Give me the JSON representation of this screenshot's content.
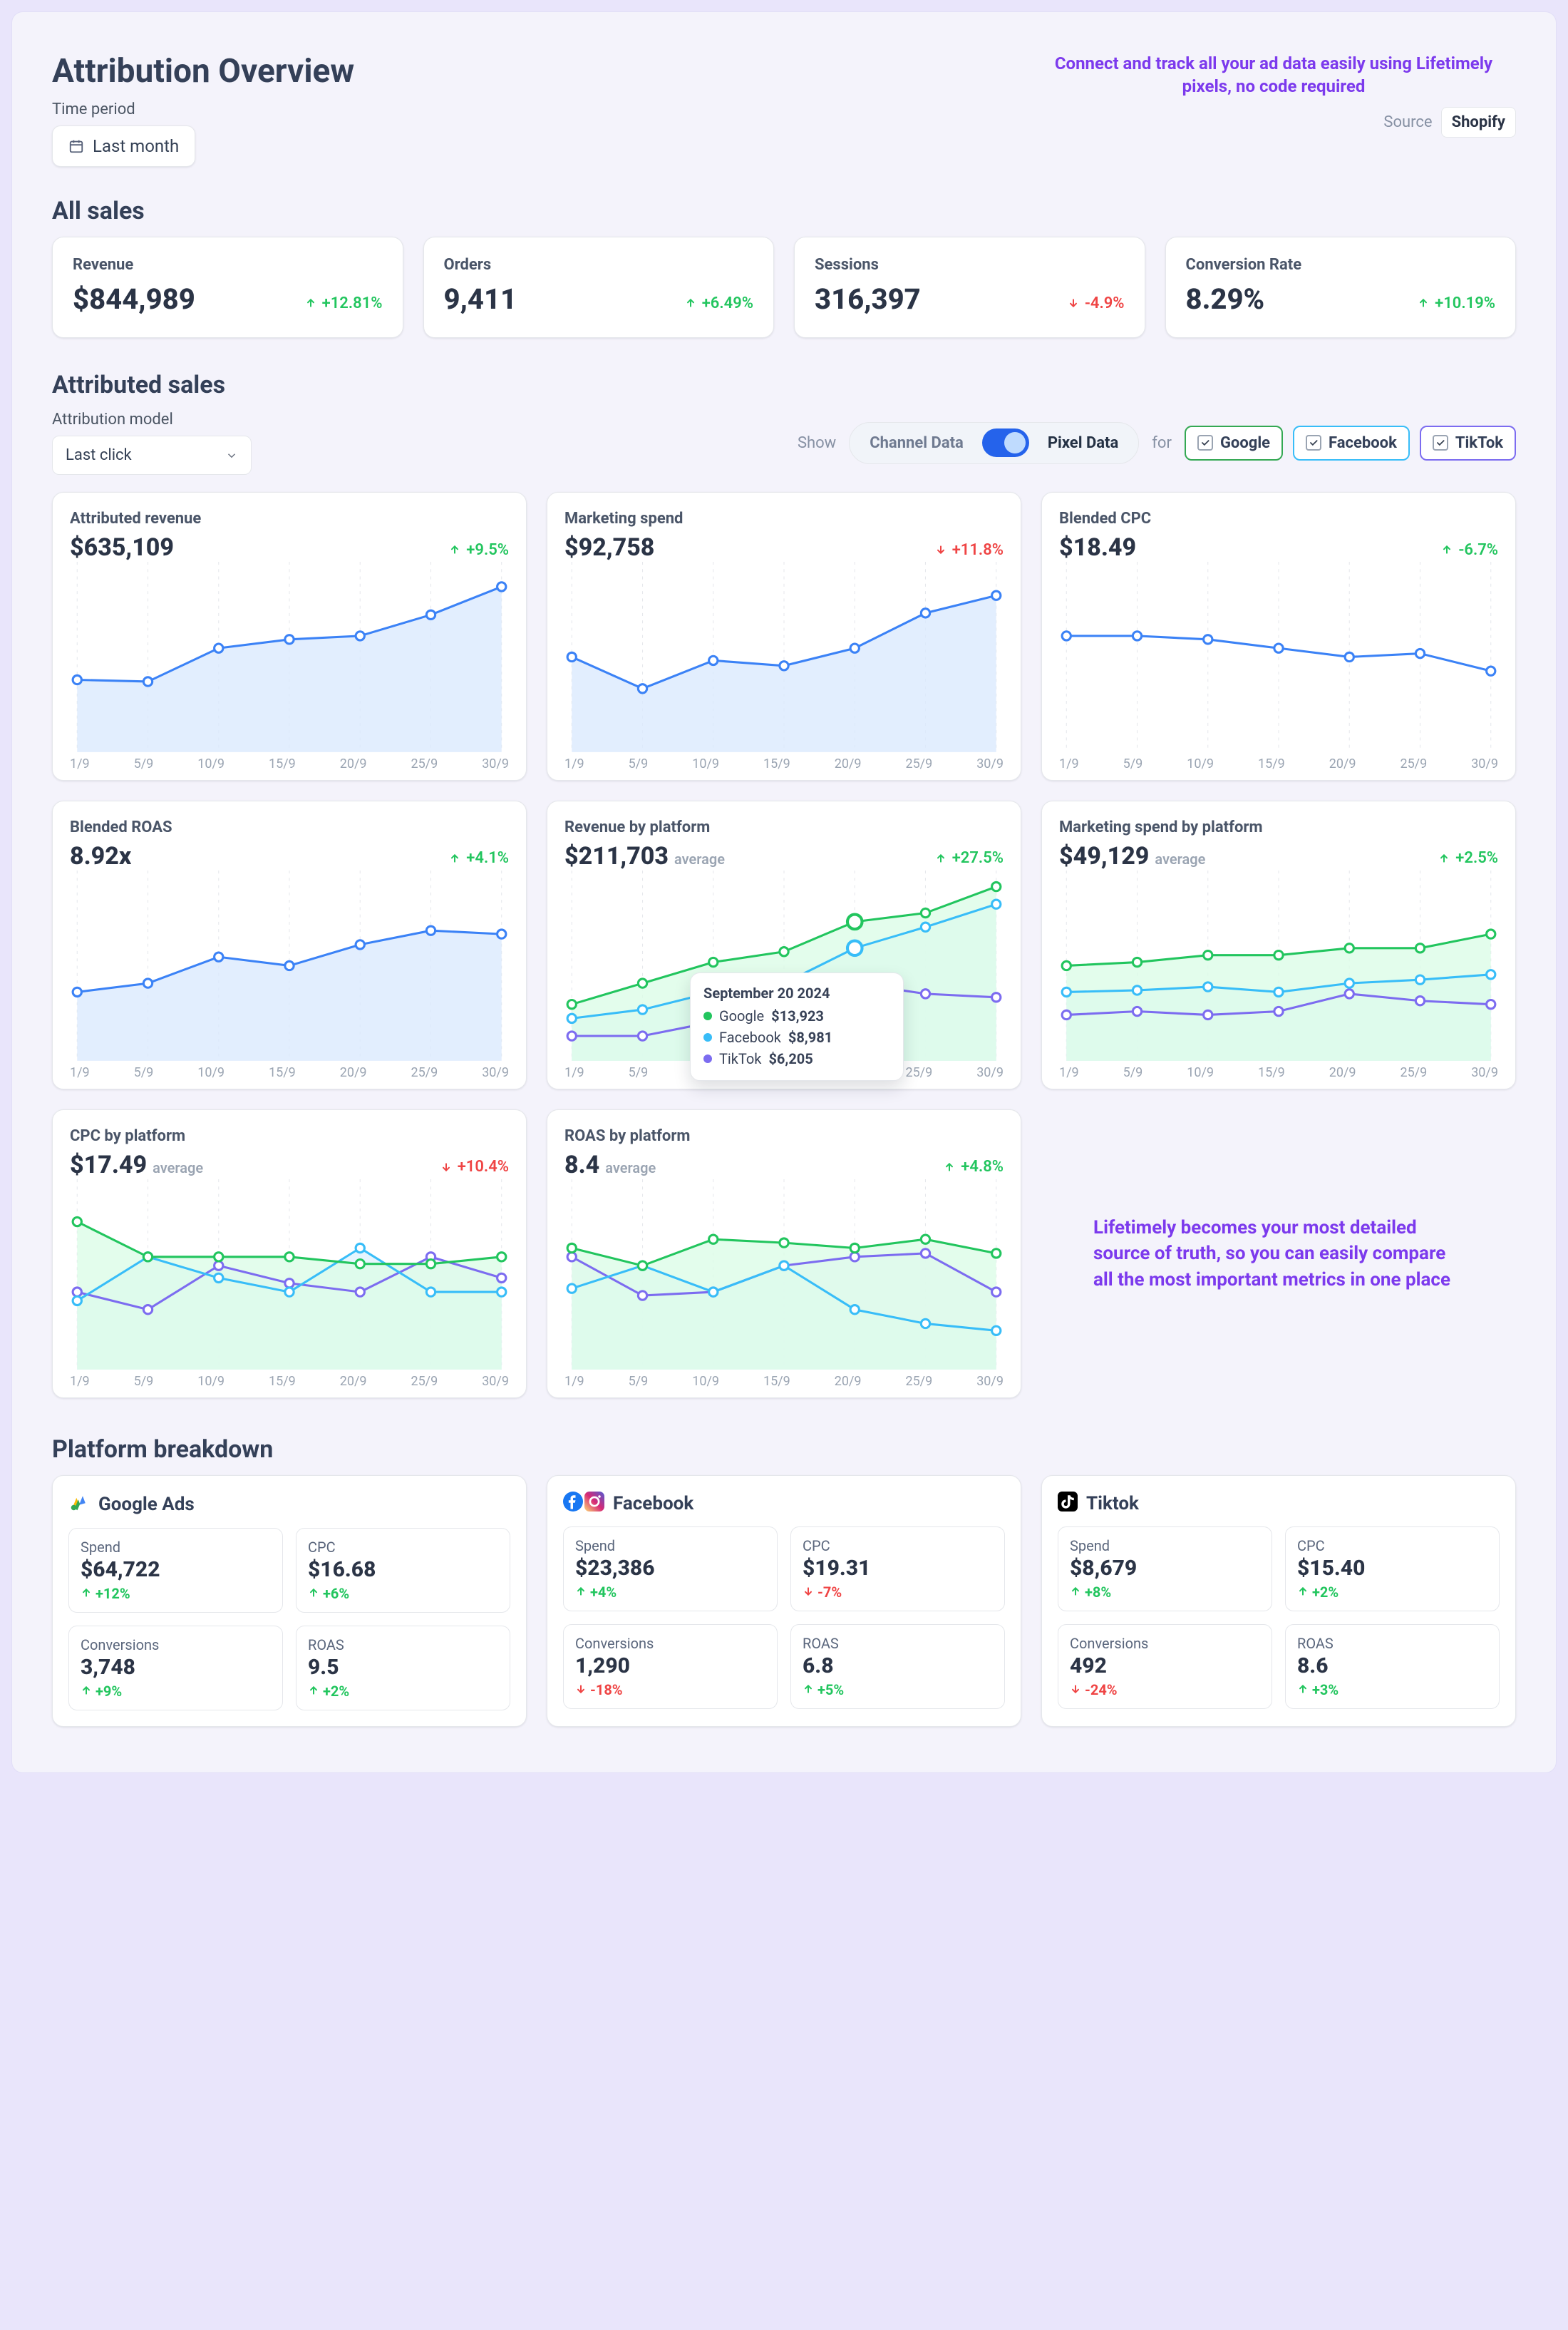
{
  "page": {
    "title": "Attribution Overview"
  },
  "time_period": {
    "label": "Time period",
    "value": "Last month"
  },
  "source": {
    "label": "Source",
    "value": "Shopify"
  },
  "annotations": {
    "top": "Connect and track all your ad data easily using Lifetimely pixels, no code required",
    "right": "Lifetimely becomes your most detailed source of truth, so you can easily compare all the most important metrics in one place"
  },
  "all_sales": {
    "heading": "All sales",
    "cards": [
      {
        "title": "Revenue",
        "value": "$844,989",
        "delta": "+12.81%",
        "dir": "up"
      },
      {
        "title": "Orders",
        "value": "9,411",
        "delta": "+6.49%",
        "dir": "up"
      },
      {
        "title": "Sessions",
        "value": "316,397",
        "delta": "-4.9%",
        "dir": "down"
      },
      {
        "title": "Conversion Rate",
        "value": "8.29%",
        "delta": "+10.19%",
        "dir": "up"
      }
    ]
  },
  "attributed": {
    "heading": "Attributed sales",
    "model_label": "Attribution model",
    "model_value": "Last click",
    "show_label": "Show",
    "seg_left": "Channel Data",
    "seg_right": "Pixel Data",
    "for_label": "for",
    "platforms": [
      {
        "id": "google",
        "label": "Google"
      },
      {
        "id": "facebook",
        "label": "Facebook"
      },
      {
        "id": "tiktok",
        "label": "TikTok"
      }
    ]
  },
  "tooltip": {
    "date": "September 20 2024",
    "rows": [
      {
        "platform": "Google",
        "value": "$13,923"
      },
      {
        "platform": "Facebook",
        "value": "$8,981"
      },
      {
        "platform": "TikTok",
        "value": "$6,205"
      }
    ]
  },
  "platform_breakdown": {
    "heading": "Platform breakdown",
    "cards": [
      {
        "name": "Google Ads",
        "icon": "google",
        "metrics": [
          {
            "label": "Spend",
            "value": "$64,722",
            "delta": "+12%",
            "dir": "up"
          },
          {
            "label": "CPC",
            "value": "$16.68",
            "delta": "+6%",
            "dir": "up"
          },
          {
            "label": "Conversions",
            "value": "3,748",
            "delta": "+9%",
            "dir": "up"
          },
          {
            "label": "ROAS",
            "value": "9.5",
            "delta": "+2%",
            "dir": "up"
          }
        ]
      },
      {
        "name": "Facebook",
        "icon": "facebook",
        "metrics": [
          {
            "label": "Spend",
            "value": "$23,386",
            "delta": "+4%",
            "dir": "up"
          },
          {
            "label": "CPC",
            "value": "$19.31",
            "delta": "-7%",
            "dir": "down"
          },
          {
            "label": "Conversions",
            "value": "1,290",
            "delta": "-18%",
            "dir": "down"
          },
          {
            "label": "ROAS",
            "value": "6.8",
            "delta": "+5%",
            "dir": "up"
          }
        ]
      },
      {
        "name": "Tiktok",
        "icon": "tiktok",
        "metrics": [
          {
            "label": "Spend",
            "value": "$8,679",
            "delta": "+8%",
            "dir": "up"
          },
          {
            "label": "CPC",
            "value": "$15.40",
            "delta": "+2%",
            "dir": "up"
          },
          {
            "label": "Conversions",
            "value": "492",
            "delta": "-24%",
            "dir": "down"
          },
          {
            "label": "ROAS",
            "value": "8.6",
            "delta": "+3%",
            "dir": "up"
          }
        ]
      }
    ]
  },
  "colors": {
    "blue": "#3b82f6",
    "blue_fill": "#dbeafe",
    "green": "#22c55e",
    "green_fill": "#dcfce7",
    "violet": "#7c6cf0",
    "violet_fill": "#ede9fe",
    "fb": "#38bdf8"
  },
  "chart_data": [
    {
      "id": "attr_rev",
      "title": "Attributed revenue",
      "value": "$635,109",
      "delta": "+9.5%",
      "dir": "up",
      "type": "line",
      "categories": [
        "1/9",
        "5/9",
        "10/9",
        "15/9",
        "20/9",
        "25/9",
        "30/9"
      ],
      "values": [
        37,
        36,
        55,
        60,
        62,
        74,
        90
      ],
      "ylim": [
        0,
        100
      ],
      "series_style": "blue_area"
    },
    {
      "id": "mkt_spend",
      "title": "Marketing spend",
      "value": "$92,758",
      "delta": "+11.8%",
      "dir": "down",
      "type": "line",
      "categories": [
        "1/9",
        "5/9",
        "10/9",
        "15/9",
        "20/9",
        "25/9",
        "30/9"
      ],
      "values": [
        50,
        32,
        48,
        45,
        55,
        75,
        85
      ],
      "ylim": [
        0,
        100
      ],
      "series_style": "blue_area"
    },
    {
      "id": "blend_cpc",
      "title": "Blended CPC",
      "value": "$18.49",
      "delta": "-6.7%",
      "dir": "up",
      "type": "line",
      "categories": [
        "1/9",
        "5/9",
        "10/9",
        "15/9",
        "20/9",
        "25/9",
        "30/9"
      ],
      "values": [
        62,
        62,
        60,
        55,
        50,
        52,
        42
      ],
      "ylim": [
        0,
        100
      ],
      "series_style": "blue_line"
    },
    {
      "id": "blend_roas",
      "title": "Blended ROAS",
      "value": "8.92x",
      "delta": "+4.1%",
      "dir": "up",
      "type": "line",
      "categories": [
        "1/9",
        "5/9",
        "10/9",
        "15/9",
        "20/9",
        "25/9",
        "30/9"
      ],
      "values": [
        35,
        40,
        55,
        50,
        62,
        70,
        68
      ],
      "ylim": [
        0,
        100
      ],
      "series_style": "blue_area"
    },
    {
      "id": "rev_platform",
      "title": "Revenue by platform",
      "value": "$211,703",
      "value_sub": "average",
      "delta": "+27.5%",
      "dir": "up",
      "type": "line",
      "categories": [
        "1/9",
        "5/9",
        "10/9",
        "15/9",
        "20/9",
        "25/9",
        "30/9"
      ],
      "series": [
        {
          "name": "Google",
          "color": "#22c55e",
          "values": [
            28,
            40,
            52,
            58,
            75,
            80,
            95
          ]
        },
        {
          "name": "Facebook",
          "color": "#38bdf8",
          "values": [
            20,
            25,
            35,
            40,
            60,
            72,
            85
          ]
        },
        {
          "name": "TikTok",
          "color": "#7c6cf0",
          "values": [
            10,
            10,
            18,
            24,
            40,
            34,
            32
          ]
        }
      ],
      "ylim": [
        0,
        100
      ],
      "highlight_index": 4,
      "tooltip": true
    },
    {
      "id": "spend_platform",
      "title": "Marketing spend by platform",
      "value": "$49,129",
      "value_sub": "average",
      "delta": "+2.5%",
      "dir": "up",
      "type": "line",
      "categories": [
        "1/9",
        "5/9",
        "10/9",
        "15/9",
        "20/9",
        "25/9",
        "30/9"
      ],
      "series": [
        {
          "name": "Google",
          "color": "#22c55e",
          "values": [
            50,
            52,
            56,
            56,
            60,
            60,
            68
          ]
        },
        {
          "name": "Facebook",
          "color": "#38bdf8",
          "values": [
            35,
            36,
            38,
            35,
            40,
            42,
            45
          ]
        },
        {
          "name": "TikTok",
          "color": "#7c6cf0",
          "values": [
            22,
            24,
            22,
            24,
            34,
            30,
            28
          ]
        }
      ],
      "ylim": [
        0,
        100
      ]
    },
    {
      "id": "cpc_platform",
      "title": "CPC by platform",
      "value": "$17.49",
      "value_sub": "average",
      "delta": "+10.4%",
      "dir": "down",
      "type": "line",
      "categories": [
        "1/9",
        "5/9",
        "10/9",
        "15/9",
        "20/9",
        "25/9",
        "30/9"
      ],
      "series": [
        {
          "name": "Google",
          "color": "#22c55e",
          "values": [
            80,
            60,
            60,
            60,
            56,
            56,
            60
          ]
        },
        {
          "name": "Facebook",
          "color": "#38bdf8",
          "values": [
            35,
            60,
            48,
            40,
            65,
            40,
            40
          ]
        },
        {
          "name": "TikTok",
          "color": "#7c6cf0",
          "values": [
            40,
            30,
            55,
            45,
            40,
            60,
            48
          ]
        }
      ],
      "ylim": [
        0,
        100
      ]
    },
    {
      "id": "roas_platform",
      "title": "ROAS by platform",
      "value": "8.4",
      "value_sub": "average",
      "delta": "+4.8%",
      "dir": "up",
      "type": "line",
      "categories": [
        "1/9",
        "5/9",
        "10/9",
        "15/9",
        "20/9",
        "25/9",
        "30/9"
      ],
      "series": [
        {
          "name": "Google",
          "color": "#22c55e",
          "values": [
            65,
            55,
            70,
            68,
            65,
            70,
            62
          ]
        },
        {
          "name": "Facebook",
          "color": "#38bdf8",
          "values": [
            42,
            55,
            40,
            55,
            30,
            22,
            18
          ]
        },
        {
          "name": "TikTok",
          "color": "#7c6cf0",
          "values": [
            60,
            38,
            40,
            55,
            60,
            62,
            40
          ]
        }
      ],
      "ylim": [
        0,
        100
      ]
    }
  ]
}
